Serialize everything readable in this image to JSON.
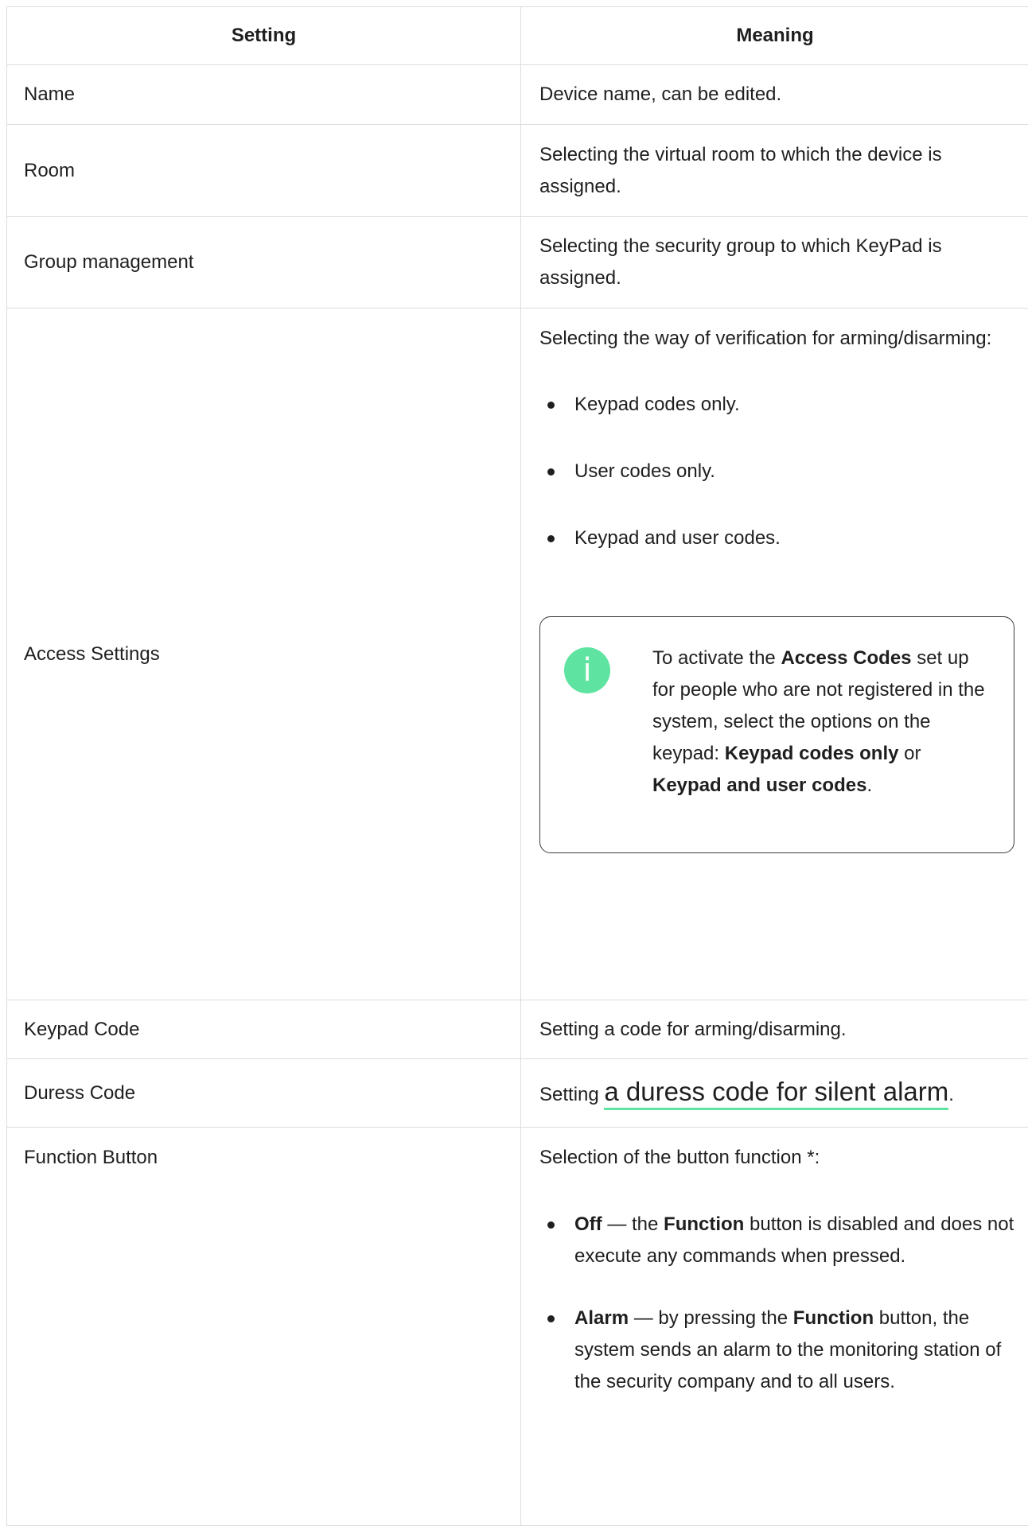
{
  "header": {
    "setting": "Setting",
    "meaning": "Meaning"
  },
  "rows": {
    "name": {
      "setting": "Name",
      "meaning": "Device name, can be edited."
    },
    "room": {
      "setting": "Room",
      "meaning": "Selecting the virtual room to which the device is assigned."
    },
    "group": {
      "setting": "Group management",
      "meaning": "Selecting the security group to which KeyPad is assigned."
    },
    "access": {
      "setting": "Access Settings",
      "intro": "Selecting the way of verification for arming/disarming:",
      "options": [
        "Keypad codes only.",
        "User codes only.",
        "Keypad and user codes."
      ],
      "note": {
        "icon": "info-icon",
        "icon_glyph": "i",
        "t1": "To activate the ",
        "b1": "Access Codes",
        "t2": " set up for people who are not registered in the system, select the options on the keypad: ",
        "b2": "Keypad codes only",
        "t3": " or ",
        "b3": "Keypad and user codes",
        "t4": "."
      }
    },
    "keypad_code": {
      "setting": "Keypad Code",
      "meaning": "Setting a code for arming/disarming."
    },
    "duress": {
      "setting": "Duress Code",
      "prefix": "Setting ",
      "link": "a duress code for silent alarm",
      "suffix": "."
    },
    "function_button": {
      "setting": "Function Button",
      "intro": "Selection of the button function *:",
      "options": [
        {
          "b1": "Off",
          "t1": " — the ",
          "b2": "Function",
          "t2": " button is disabled and does not execute any commands when pressed."
        },
        {
          "b1": "Alarm",
          "t1": " — by pressing the ",
          "b2": "Function",
          "t2": " button, the system sends an alarm to the monitoring station of the security company and to all users."
        }
      ]
    }
  },
  "colors": {
    "accent": "#5ee3a0",
    "border": "#dcdcdc",
    "text": "#1f1f1f"
  }
}
